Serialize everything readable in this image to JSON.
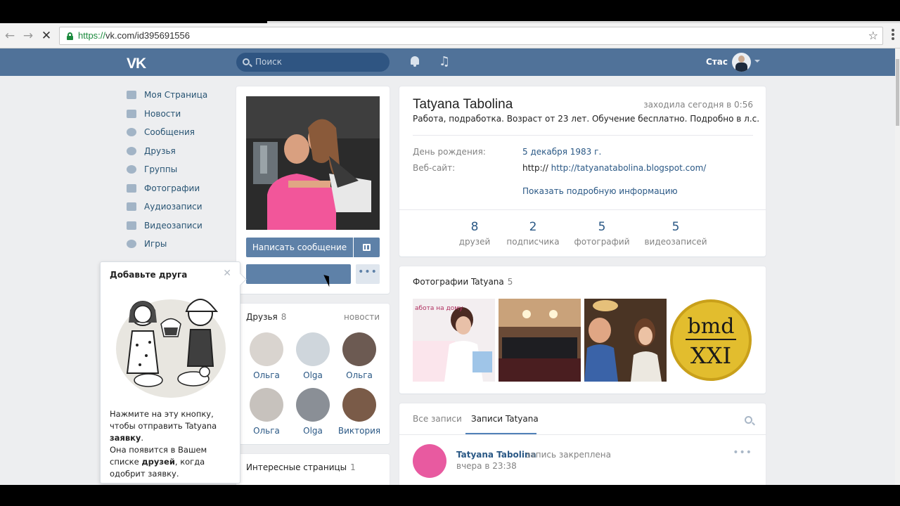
{
  "browser": {
    "url_scheme": "https://",
    "url_rest": "vk.com/id395691556"
  },
  "header": {
    "search_placeholder": "Поиск",
    "user_name": "Стас"
  },
  "menu": [
    {
      "label": "Моя Страница",
      "icon": "home-icon"
    },
    {
      "label": "Новости",
      "icon": "news-icon"
    },
    {
      "label": "Сообщения",
      "icon": "messages-icon"
    },
    {
      "label": "Друзья",
      "icon": "friends-icon"
    },
    {
      "label": "Группы",
      "icon": "groups-icon"
    },
    {
      "label": "Фотографии",
      "icon": "photo-icon"
    },
    {
      "label": "Аудиозаписи",
      "icon": "music-icon"
    },
    {
      "label": "Видеозаписи",
      "icon": "video-icon"
    },
    {
      "label": "Игры",
      "icon": "games-icon"
    }
  ],
  "popup": {
    "title": "Добавьте друга",
    "text1_a": "Нажмите на эту кнопку, чтобы отправить Tatyana ",
    "text1_b": "заявку",
    "text1_c": ".",
    "text2_a": "Она появится в Вашем списке ",
    "text2_b": "друзей",
    "text2_c": ", когда одобрит заявку."
  },
  "profile_actions": {
    "write_message": "Написать сообщение"
  },
  "friends": {
    "title": "Друзья",
    "count": "8",
    "link": "новости",
    "items": [
      {
        "name": "Ольга",
        "color": "#d9d4cf"
      },
      {
        "name": "Olga",
        "color": "#cfd6dc"
      },
      {
        "name": "Ольга",
        "color": "#6c5a52"
      },
      {
        "name": "Ольга",
        "color": "#c7c2bd"
      },
      {
        "name": "Olga",
        "color": "#8a8f96"
      },
      {
        "name": "Виктория",
        "color": "#7a5b48"
      }
    ]
  },
  "interesting": {
    "title": "Интересные страницы",
    "count": "1"
  },
  "profile": {
    "name": "Tatyana Tabolina",
    "online": "заходила сегодня в 0:56",
    "status": "Работа, подработка. Возраст от 23 лет. Обучение бесплатно. Подробно в л.с.",
    "birthday_label": "День рождения:",
    "birthday_value": "5 декабря 1983 г.",
    "website_label": "Веб-сайт:",
    "website_prefix": "http://",
    "website_value": "http://tatyanatabolina.blogspot.com/",
    "more_info": "Показать подробную информацию",
    "counters": [
      {
        "n": "8",
        "l": "друзей"
      },
      {
        "n": "2",
        "l": "подписчика"
      },
      {
        "n": "5",
        "l": "фотографий"
      },
      {
        "n": "5",
        "l": "видеозаписей"
      }
    ]
  },
  "photos": {
    "title": "Фотографии Tatyana",
    "count": "5",
    "thumb1_text": "абота на дому",
    "thumb4_line1": "bmd",
    "thumb4_line2": "XXI"
  },
  "wall": {
    "tab_all": "Все записи",
    "tab_own": "Записи Tatyana",
    "post_author": "Tatyana Tabolina",
    "post_pinned": "запись закреплена",
    "post_time": "вчера в 23:38"
  }
}
